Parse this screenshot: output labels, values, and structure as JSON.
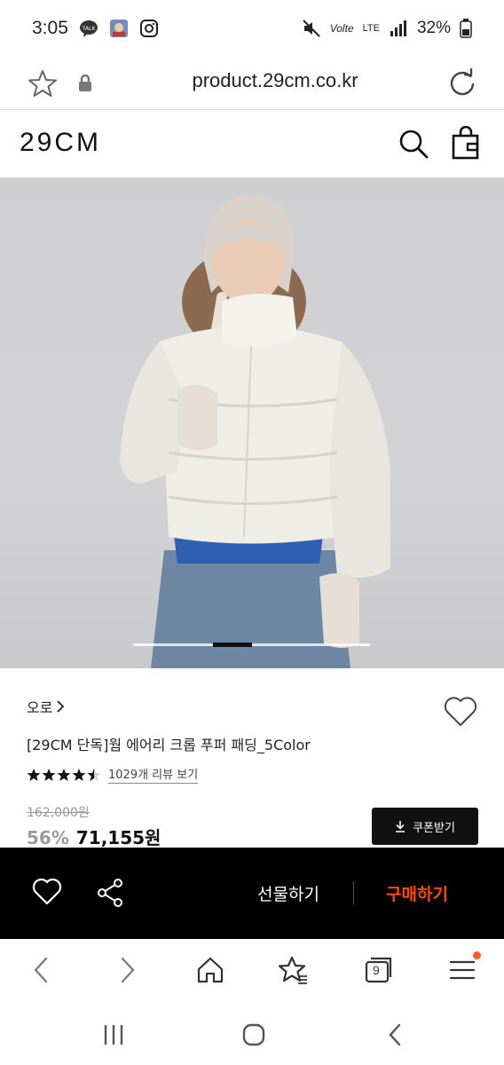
{
  "status_bar": {
    "time": "3:05",
    "network": "Volte",
    "lte": "LTE",
    "battery": "32%"
  },
  "browser": {
    "url": "product.29cm.co.kr"
  },
  "site": {
    "logo": "29CM"
  },
  "product": {
    "brand": "오로",
    "title": "[29CM 단독]웜 에어리 크롭 푸퍼 패딩_5Color",
    "rating": 4.5,
    "review_link": "1029개 리뷰 보기",
    "original_price": "162,000원",
    "discount": "56%",
    "sale_price": "71,155원",
    "coupon_label": "쿠폰받기",
    "image_page": 2,
    "image_count": 6
  },
  "purchase_bar": {
    "gift_label": "선물하기",
    "buy_label": "구매하기"
  },
  "browser_toolbar": {
    "tabs_count": "9"
  },
  "colors": {
    "accent": "#ff4800",
    "bar_bg": "#000000",
    "notify_dot": "#ff5a1f"
  },
  "icons": [
    "star-icon",
    "lock-icon",
    "reload-icon",
    "search-icon",
    "bag-icon",
    "heart-icon",
    "share-icon",
    "download-icon",
    "back-icon",
    "forward-icon",
    "home-icon",
    "bookmark-star-icon",
    "tabs-icon",
    "menu-icon",
    "recents-icon",
    "home-circle-icon",
    "nav-back-icon"
  ]
}
